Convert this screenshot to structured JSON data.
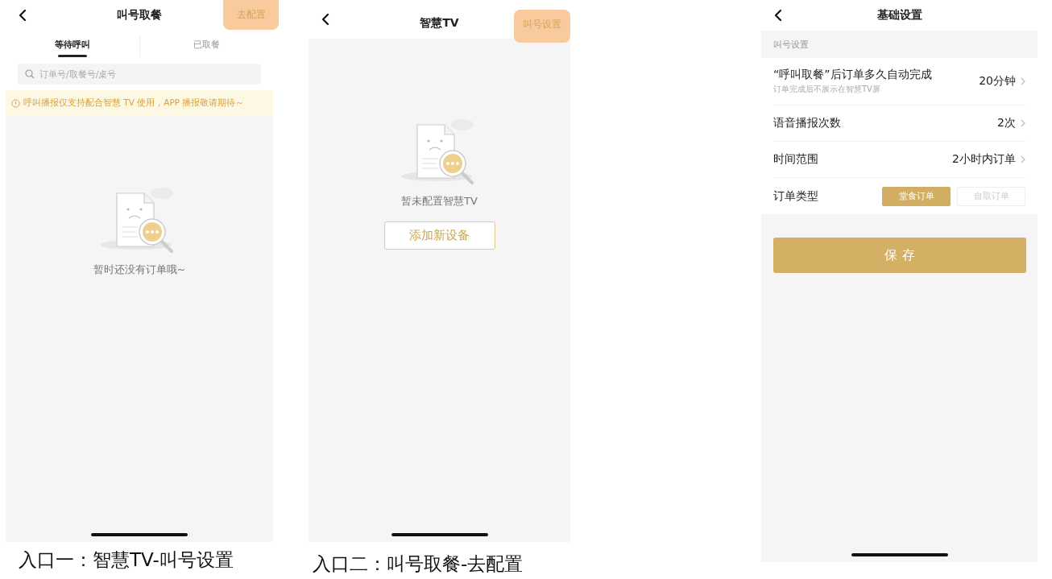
{
  "screens": [
    {
      "kind": "orders",
      "title": "叫号取餐",
      "action": {
        "label": "去配置",
        "highlighted": true
      },
      "tabs": [
        {
          "label": "等待呼叫",
          "selected": true
        },
        {
          "label": "已取餐",
          "selected": false
        }
      ],
      "search": {
        "placeholder": "订单号/取餐号/桌号"
      },
      "notice": "呼叫播报仅支持配合智慧 TV 使用，APP 播报敬请期待～",
      "empty_text": "暂时还没有订单哦~",
      "caption": "入口一：智慧TV-叫号设置"
    },
    {
      "kind": "tv",
      "title": "智慧TV",
      "action": {
        "label": "叫号设置",
        "highlighted": true
      },
      "empty_text": "暂未配置智慧TV",
      "add_button": "添加新设备",
      "caption": "入口二：叫号取餐-去配置"
    },
    {
      "kind": "settings",
      "title": "基础设置",
      "section": "叫号设置",
      "rows": [
        {
          "kind": "value",
          "label": "“呼叫取餐”后订单多久自动完成",
          "hint": "订单完成后不展示在智慧TV屏",
          "value": "20分钟"
        },
        {
          "kind": "value",
          "label": "语音播报次数",
          "value": "2次"
        },
        {
          "kind": "value",
          "label": "时间范围",
          "value": "2小时内订单"
        },
        {
          "kind": "choice",
          "label": "订单类型",
          "options": [
            {
              "label": "堂食订单",
              "selected": true
            },
            {
              "label": "自取订单",
              "selected": false
            }
          ]
        }
      ],
      "save_button": "保 存"
    }
  ]
}
